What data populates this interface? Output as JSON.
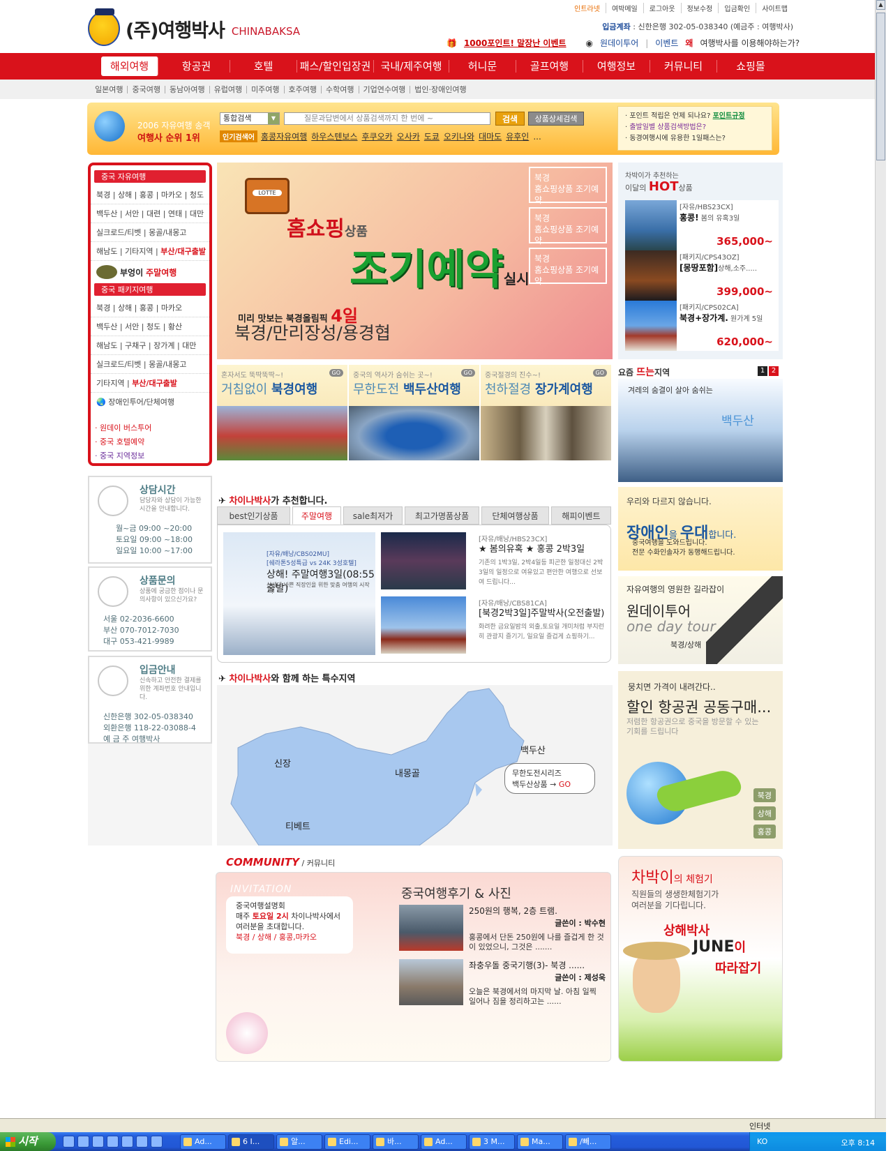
{
  "top_links": [
    "인트라넷",
    "여박메일",
    "로그아웃",
    "정보수정",
    "입금확인",
    "사이트맵"
  ],
  "logo": {
    "kor": "(주)여행박사",
    "eng": "CHINABAKSA"
  },
  "account": {
    "label": "입금계좌",
    "text": " : 신한은행  302-05-038340 (예금주 : 여행박사)"
  },
  "subpromo": {
    "event": "1000포인트! 말장난 이벤트",
    "oneday": "원데이투어",
    "event2": "이벤트",
    "why": "여행박사를 이용해야하는가?"
  },
  "nav": [
    "해외여행",
    "항공권",
    "호텔",
    "패스/할인입장권",
    "국내/제주여행",
    "허니문",
    "골프여행",
    "여행정보",
    "커뮤니티",
    "쇼핑몰"
  ],
  "subnav": [
    "일본여행",
    "중국여행",
    "동남아여행",
    "유럽여행",
    "미주여행",
    "호주여행",
    "수학여행",
    "기업연수여행",
    "법인·장애인여행"
  ],
  "searchband": {
    "rank_line1": "2006 자유여행 송객",
    "rank_line2": "여행사 순위 1위",
    "select": "통합검색",
    "placeholder": "질문과답변에서 상품검색까지 한 번에 ~",
    "search_btn": "검색",
    "detail_btn": "상품상세검색",
    "popular_tag": "인기검색어",
    "keywords": [
      "홍콩자유여행",
      "하우스텐보스",
      "후쿠오카",
      "오사카",
      "도쿄",
      "오키나와",
      "대마도",
      "유후인",
      "..."
    ],
    "faq": [
      "포인트 적립은 언제 되나요?",
      "포인트규정",
      "출발일별 상품검색방법은?",
      "동경여행시에 유용한 1일패스는?"
    ]
  },
  "left": {
    "free_title": "중국 자유여행",
    "free_rows": [
      "북경 | 상해 | 홍콩 | 마카오 | 청도",
      "백두산 | 서안 | 대련 | 연태 | 대만",
      "실크로드/티벳    |    몽골/내몽고",
      "해남도 | 기타지역 | "
    ],
    "free_red": "부산/대구출발",
    "owl": "부엉이",
    "owl_red": "주말여행",
    "pkg_title": "중국 패키지여행",
    "pkg_rows": [
      "북경  |  상해  |  홍콩  |  마카오",
      "백두산  |  서안  |  청도  |  황산",
      "해남도  |  구채구  |  장가계  |  대만",
      "실크로드/티벳    |    몽골/내몽고",
      "기타지역  |  "
    ],
    "pkg_red": "부산/대구출발",
    "group": "장애인투어/단체여행",
    "extras": [
      "원데이 버스투어",
      "중국 호텔예약",
      "중국 지역정보"
    ]
  },
  "consult": {
    "title": "상담시간",
    "desc": "담당자와 상담이 가능한 시간을 안내합니다.",
    "lines": [
      "월~금  09:00 ~20:00",
      "토요일  09:00 ~18:00",
      "일요일  10:00 ~17:00"
    ]
  },
  "inquiry": {
    "title": "상품문의",
    "desc": "상품에 궁금한 점이나 문의사항이 있으신가요?",
    "lines": [
      "서울  02-2036-6600",
      "부산  070-7012-7030",
      "대구  053-421-9989"
    ]
  },
  "deposit": {
    "title": "입금안내",
    "desc": "신속하고 안전한 결제를 위한 계좌번호 안내입니다.",
    "lines": [
      "신한은행  302-05-038340",
      "외환은행  118-22-03088-4",
      "예 금 주  여행박사"
    ]
  },
  "main_banner": {
    "tv": "LOTTE",
    "t1": "홈쇼핑",
    "t1s": "상품",
    "t2": "조기예약",
    "t2s": "실시",
    "t3": "미리 맛보는 북경올림픽",
    "t3b": "4일",
    "t4": "북경/만리장성/용경협",
    "buttons": [
      "북경\n홈쇼핑상품 조기예약",
      "북경\n홈쇼핑상품 조기예약",
      "북경\n홈쇼핑상품 조기예약"
    ]
  },
  "destinations": [
    {
      "sub": "혼자서도 뚝딱뚝딱~!",
      "title": "거침없이",
      "bold": "북경여행",
      "go": "GO"
    },
    {
      "sub": "중국의 역사가 숨쉬는 곳~!",
      "title": "무한도전",
      "bold": "백두산여행",
      "go": "GO"
    },
    {
      "sub": "중국절경의 진수~!",
      "title": "천하절경",
      "bold": "장가계여행",
      "go": "GO"
    }
  ],
  "hot": {
    "header1": "차박이가 추천하는",
    "header2": "이달의",
    "header_hot": "HOT",
    "header3": "상품",
    "items": [
      {
        "code": "[자유/HBS23CX]",
        "title": "홍콩!",
        "desc": " 봄의 유혹3일",
        "price": "365,000~"
      },
      {
        "code": "[패키지/CPS43OZ]",
        "title": "[몽땅포함]",
        "desc": "상해,소주.....",
        "price": "399,000~"
      },
      {
        "code": "[패키지/CPS02CA]",
        "title": "북경+장가계.",
        "desc": " 원가계 5일",
        "price": "620,000~"
      }
    ]
  },
  "hotspot": {
    "header": "요즘",
    "hot": "뜨는",
    "header2": "지역",
    "pages": [
      "1",
      "2"
    ],
    "caption": "겨레의 숨결이 살아 숨쉬는",
    "place": "백두산"
  },
  "recommend": {
    "title_red": "차이나박사",
    "title": "가 추천합니다.",
    "tabs": [
      "best인기상품",
      "주말여행",
      "sale최저가",
      "최고가명품상품",
      "단체여행상품",
      "해피이벤트"
    ],
    "big": {
      "code": "[자유/배낭/CBS02MU]",
      "code2": "[쉐라톤5성특급 vs 24K 3성호텔]",
      "title": "상해! 주말여행3일(08:55 출발)",
      "desc": "신세대 바쁜 직장인을 위한 맞춤 여행의 시작~!"
    },
    "items": [
      {
        "code": "[자유/배낭/HBS23CX]",
        "title": "★ 봄의유혹 ★ 홍콩 2박3일",
        "desc": "기존의 1박3일, 2박4일등 피곤한 일정대신 2박3일의 일정으로 여유있고 편안한 여행으로 선보여 드립니다..."
      },
      {
        "code": "[자유/배낭/CBS81CA]",
        "title": "[북경2박3일]주말박사(오전출발)",
        "desc": "화려한 금요일밤의 외출,토요일 개미처럼 부지런히 관광지 즐기기, 일요일 즐겁게 쇼핑하기..."
      }
    ]
  },
  "special": {
    "title_red": "차이나박사",
    "title": "와 함께 하는 특수지역",
    "labels": [
      "신장",
      "내몽골",
      "티베트",
      "백두산"
    ],
    "bubble1": "무한도전시리즈",
    "bubble2": "백두산상품 → ",
    "bubble_go": "GO"
  },
  "promo1": {
    "a": "우리와 다르지 않습니다.",
    "b": "장애인",
    "b2": "을 ",
    "b3": "우대",
    "b4": "합니다.",
    "c1": "중국여행을 도와드립니다.",
    "c2": "전문 수화인솔자가 동행해드립니다."
  },
  "promo2": {
    "a": "자유여행의 영원한 길라잡이",
    "b": "원데이투어",
    "c": "one day tour",
    "d": "북경/상해"
  },
  "promo3": {
    "a": "뭉치면 가격이 내려간다..",
    "b": "할인 항공권 공동구매...",
    "c": "저렴한 항공권으로 중국을 방문할 수 있는 기회를 드립니다",
    "tags": [
      "북경",
      "상해",
      "홍콩"
    ]
  },
  "community": {
    "title": "COMMUNITY",
    "title_sub": " / 커뮤니티",
    "invitation": "INVITATION",
    "inv_title": "중국여행설명회",
    "inv_pre": "매주 ",
    "inv_red": "토요일 2시",
    "inv_post": " 차이나박사에서",
    "inv_line3": "여러분을 초대합니다.",
    "inv_cities": "북경 / 상해 / 홍콩,마카오",
    "reviews_title": "중국여행후기 & 사진",
    "reviews": [
      {
        "title": "250원의 행복, 2층 트램.",
        "writer": "글쓴이 : 박수현",
        "desc": "홍콩에서 단돈 250원에 나를 즐겁게 한 것이 있었으니, 그것은 ......."
      },
      {
        "title": "좌충우돌 중국기행(3)- 북경 ......",
        "writer": "글쓴이 : 제성욱",
        "desc": "오늘은 북경에서의 마지막 날. 아침 일찍 일어나 짐을 정리하고는 ......"
      }
    ]
  },
  "experience": {
    "a": "차박이",
    "a2": "의 체험기",
    "b1": "직원들의 생생한체험기가",
    "b2": "여러분을 기다립니다.",
    "c": "상해박사",
    "d": "JUNE",
    "d2": "이",
    "e": "따라잡기"
  },
  "statusbar": {
    "zone": "인터넷"
  },
  "taskbar": {
    "start": "시작",
    "tasks": [
      "Ad...",
      "6 I...",
      "알...",
      "Edi...",
      "바...",
      "Ad...",
      "3 M...",
      "Ma...",
      "/빼..."
    ],
    "lang": "KO",
    "clock": "오후 8:14"
  }
}
